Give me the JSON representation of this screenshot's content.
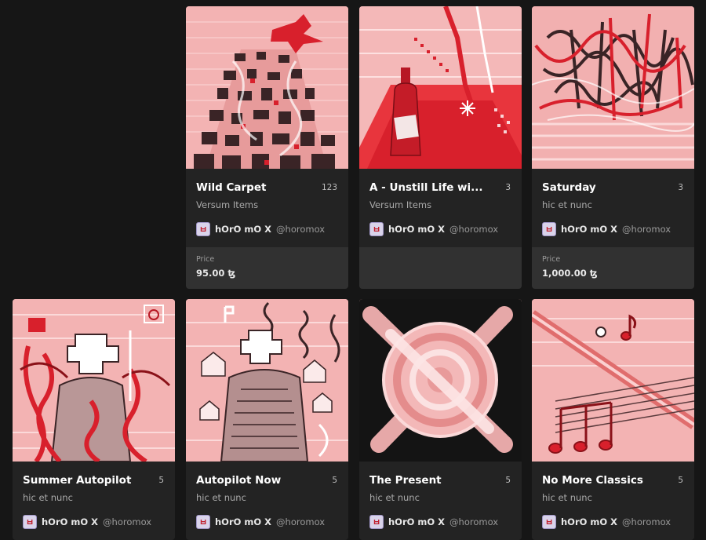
{
  "price_label": "Price",
  "currency_symbol": "ꜩ",
  "colors": {
    "background": "#161616",
    "card": "#232323",
    "price_panel": "#313131",
    "accent_red": "#d8202c",
    "art_pink": "#f3b3b3"
  },
  "cards": [
    {
      "title": "Wild Carpet",
      "count": "123",
      "platform": "Versum Items",
      "creator_name": "hOrO mO X",
      "creator_handle": "@horomox",
      "avatar_glyph": "ㅂ",
      "price": "95.00 ꜩ",
      "art": "carpet-artwork"
    },
    {
      "title": "A - Unstill Life wi...",
      "count": "3",
      "platform": "Versum Items",
      "creator_name": "hOrO mO X",
      "creator_handle": "@horomox",
      "avatar_glyph": "ㅂ",
      "price": "",
      "art": "bottle-artwork"
    },
    {
      "title": "Saturday",
      "count": "3",
      "platform": "hic et nunc",
      "creator_name": "hOrO mO X",
      "creator_handle": "@horomox",
      "avatar_glyph": "ㅂ",
      "price": "1,000.00 ꜩ",
      "art": "scribble-artwork"
    },
    {
      "title": "Summer Autopilot",
      "count": "5",
      "platform": "hic et nunc",
      "creator_name": "hOrO mO X",
      "creator_handle": "@horomox",
      "avatar_glyph": "ㅂ",
      "art": "summer-autopilot-artwork"
    },
    {
      "title": "Autopilot Now",
      "count": "5",
      "platform": "hic et nunc",
      "creator_name": "hOrO mO X",
      "creator_handle": "@horomox",
      "avatar_glyph": "ㅂ",
      "art": "autopilot-now-artwork"
    },
    {
      "title": "The Present",
      "count": "5",
      "platform": "hic et nunc",
      "creator_name": "hOrO mO X",
      "creator_handle": "@horomox",
      "avatar_glyph": "ㅂ",
      "art": "present-artwork"
    },
    {
      "title": "No More Classics",
      "count": "5",
      "platform": "hic et nunc",
      "creator_name": "hOrO mO X",
      "creator_handle": "@horomox",
      "avatar_glyph": "ㅂ",
      "art": "music-notes-artwork"
    }
  ]
}
